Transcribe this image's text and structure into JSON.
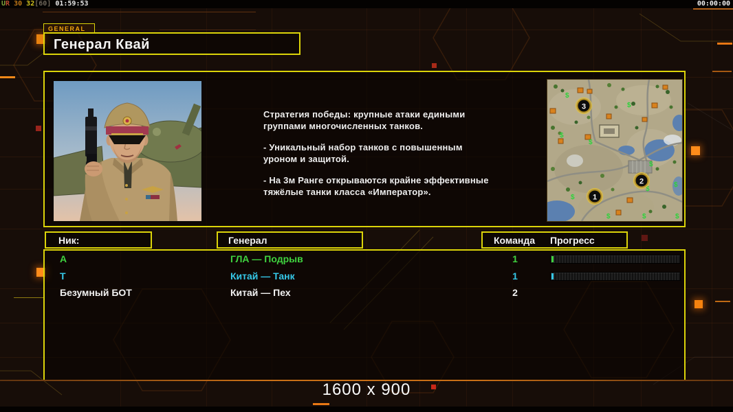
{
  "status_overlay": {
    "letter_u": "U",
    "letter_r": "R",
    "fps_current": "30",
    "fps_average": "32",
    "fps_cap": "[60]",
    "clock": "01:59:53",
    "match_timer": "00:00:00"
  },
  "tab": {
    "label": "GENERAL"
  },
  "header": {
    "title": "Генерал Квай"
  },
  "strategy": {
    "p1": "Стратегия победы: крупные атаки едиными группами многочисленных танков.",
    "p2": "- Уникальный набор танков с повышенным уроном и защитой.",
    "p3": "- На 3м Ранге открываются крайне эффективные тяжёлые танки класса «Император»."
  },
  "minimap": {
    "marker_1": "1",
    "marker_2": "2",
    "marker_3": "3"
  },
  "table": {
    "headers": {
      "nick": "Ник:",
      "general": "Генерал",
      "team": "Команда",
      "progress": "Прогресс"
    },
    "rows": [
      {
        "nick": "A",
        "general": "ГЛА — Подрыв",
        "team": "1",
        "accent": "#3fd23f",
        "has_progress_bar": true
      },
      {
        "nick": "T",
        "general": "Китай — Танк",
        "team": "1",
        "accent": "#35c8e8",
        "has_progress_bar": true
      },
      {
        "nick": "Безумный БОТ",
        "general": "Китай — Пех",
        "team": "2",
        "accent": "#f2f2f2",
        "has_progress_bar": false
      }
    ]
  },
  "footer": {
    "resolution": "1600 x 900"
  },
  "colors": {
    "frame_yellow": "#dcd409",
    "accent_orange": "#f08018",
    "row_green": "#3fd23f",
    "row_cyan": "#35c8e8"
  }
}
